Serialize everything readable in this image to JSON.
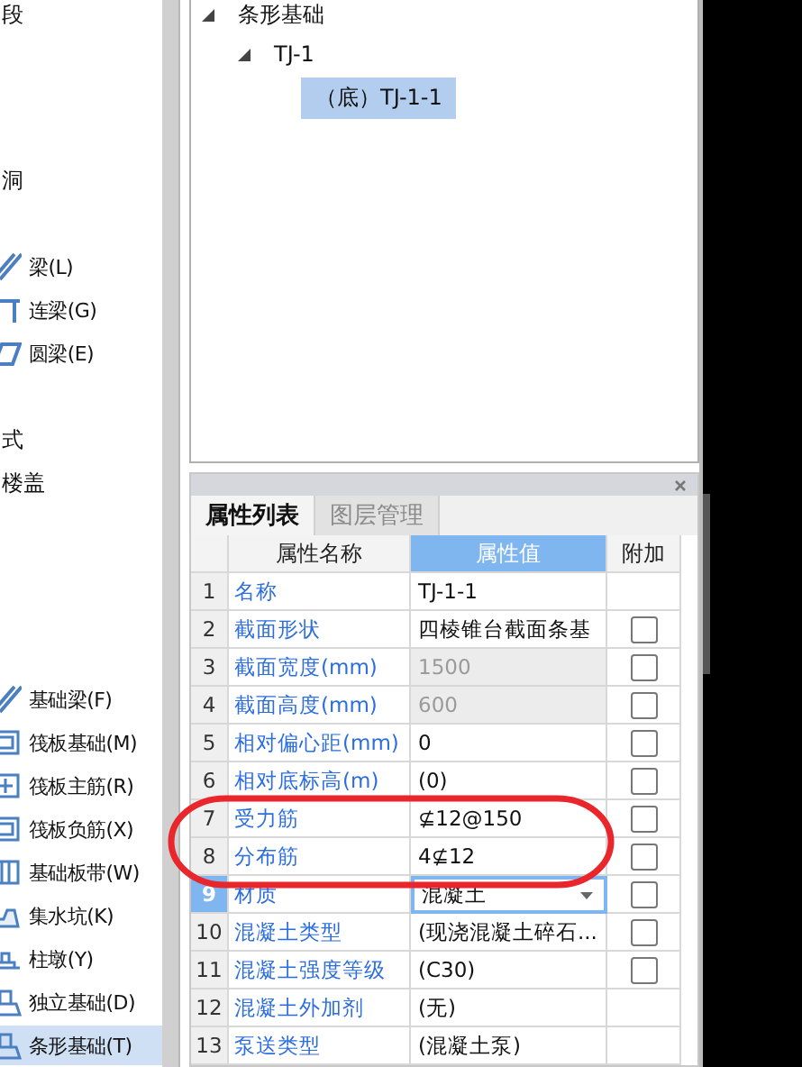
{
  "sidebar": {
    "items": [
      {
        "kind": "heading",
        "label": "段"
      },
      {
        "kind": "heading",
        "label": "洞"
      },
      {
        "kind": "tool",
        "label": "梁(L)",
        "selected": false
      },
      {
        "kind": "tool",
        "label": "连梁(G)",
        "selected": false
      },
      {
        "kind": "tool",
        "label": "圆梁(E)",
        "selected": false
      },
      {
        "kind": "heading",
        "label": "式"
      },
      {
        "kind": "heading",
        "label": "楼盖"
      },
      {
        "kind": "tool",
        "label": "基础梁(F)",
        "selected": false
      },
      {
        "kind": "tool",
        "label": "筏板基础(M)",
        "selected": false
      },
      {
        "kind": "tool",
        "label": "筏板主筋(R)",
        "selected": false
      },
      {
        "kind": "tool",
        "label": "筏板负筋(X)",
        "selected": false
      },
      {
        "kind": "tool",
        "label": "基础板带(W)",
        "selected": false
      },
      {
        "kind": "tool",
        "label": "集水坑(K)",
        "selected": false
      },
      {
        "kind": "tool",
        "label": "柱墩(Y)",
        "selected": false
      },
      {
        "kind": "tool",
        "label": "独立基础(D)",
        "selected": false
      },
      {
        "kind": "tool",
        "label": "条形基础(T)",
        "selected": true
      }
    ]
  },
  "tree": {
    "label": "条形基础",
    "expanded": true,
    "children": [
      {
        "label": "TJ-1",
        "expanded": true,
        "selected": false,
        "children": [
          {
            "label": "（底）TJ-1-1",
            "selected": true
          }
        ]
      }
    ]
  },
  "properties": {
    "tabs": [
      {
        "label": "属性列表",
        "selected": true
      },
      {
        "label": "图层管理",
        "selected": false
      }
    ],
    "columns": [
      "属性名称",
      "属性值",
      "附加"
    ],
    "rows": [
      {
        "index": "1",
        "name": "名称",
        "value": "TJ-1-1",
        "disabled": false,
        "selected": false
      },
      {
        "index": "2",
        "name": "截面形状",
        "value": "四棱锥台截面条基",
        "disabled": false,
        "selected": false,
        "checked": false
      },
      {
        "index": "3",
        "name": "截面宽度(mm)",
        "value": "1500",
        "disabled": true,
        "selected": false,
        "checked": false
      },
      {
        "index": "4",
        "name": "截面高度(mm)",
        "value": "600",
        "disabled": true,
        "selected": false,
        "checked": false
      },
      {
        "index": "5",
        "name": "相对偏心距(mm)",
        "value": "0",
        "disabled": false,
        "selected": false,
        "checked": false
      },
      {
        "index": "6",
        "name": "相对底标高(m)",
        "value": "(0)",
        "disabled": false,
        "selected": false,
        "checked": false
      },
      {
        "index": "7",
        "name": "受力筋",
        "value": "⊈12@150",
        "disabled": false,
        "selected": false,
        "checked": false
      },
      {
        "index": "8",
        "name": "分布筋",
        "value": "4⊈12",
        "disabled": false,
        "selected": false,
        "checked": false
      },
      {
        "index": "9",
        "name": "材质",
        "value": "混凝土",
        "disabled": false,
        "selected": true,
        "checked": false
      },
      {
        "index": "10",
        "name": "混凝土类型",
        "value": "(现浇混凝土碎石...",
        "disabled": false,
        "selected": false,
        "checked": false
      },
      {
        "index": "11",
        "name": "混凝土强度等级",
        "value": "(C30)",
        "disabled": false,
        "selected": false,
        "checked": false
      },
      {
        "index": "12",
        "name": "混凝土外加剂",
        "value": "(无)",
        "disabled": false,
        "selected": false
      },
      {
        "index": "13",
        "name": "泵送类型",
        "value": "(混凝土泵)",
        "disabled": false,
        "selected": false
      }
    ]
  }
}
